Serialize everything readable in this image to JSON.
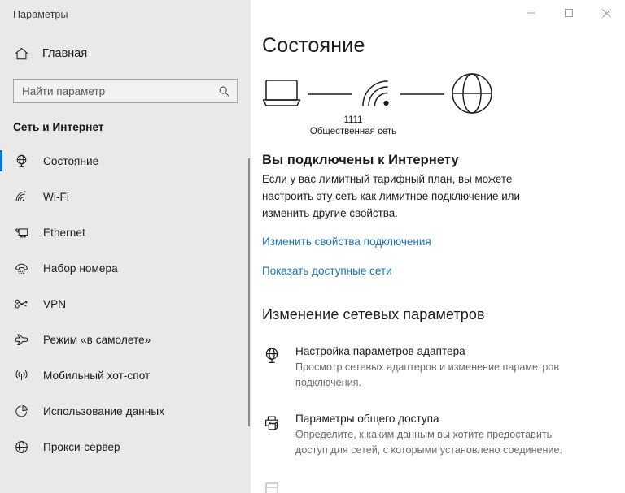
{
  "window": {
    "app_title": "Параметры",
    "controls": [
      {
        "name": "minimize",
        "label": "Свернуть"
      },
      {
        "name": "maximize",
        "label": "Развернуть"
      },
      {
        "name": "close",
        "label": "Закрыть"
      }
    ]
  },
  "sidebar": {
    "home_label": "Главная",
    "home_icon": "home-icon",
    "search": {
      "placeholder": "Найти параметр",
      "value": "",
      "icon": "search-icon"
    },
    "group_header": "Сеть и Интернет",
    "items": [
      {
        "label": "Состояние",
        "icon": "network-status-icon",
        "selected": true
      },
      {
        "label": "Wi-Fi",
        "icon": "wifi-icon",
        "selected": false
      },
      {
        "label": "Ethernet",
        "icon": "ethernet-icon",
        "selected": false
      },
      {
        "label": "Набор номера",
        "icon": "dialup-phone-icon",
        "selected": false
      },
      {
        "label": "VPN",
        "icon": "vpn-icon",
        "selected": false
      },
      {
        "label": "Режим «в самолете»",
        "icon": "airplane-icon",
        "selected": false
      },
      {
        "label": "Мобильный хот-спот",
        "icon": "hotspot-icon",
        "selected": false
      },
      {
        "label": "Использование данных",
        "icon": "data-usage-pie-icon",
        "selected": false
      },
      {
        "label": "Прокси-сервер",
        "icon": "proxy-globe-icon",
        "selected": false
      }
    ]
  },
  "main": {
    "page_title": "Состояние",
    "diagram": {
      "device_icon": "laptop-icon",
      "link_icon": "wifi-signal-icon",
      "internet_icon": "globe-icon",
      "ssid": "1111",
      "network_type": "Общественная сеть"
    },
    "status": {
      "heading": "Вы подключены к Интернету",
      "description": "Если у вас лимитный тарифный план, вы можете настроить эту сеть как лимитное подключение или изменить другие свойства."
    },
    "links": [
      {
        "label": "Изменить свойства подключения"
      },
      {
        "label": "Показать доступные сети"
      }
    ],
    "settings_section": {
      "heading": "Изменение сетевых параметров",
      "options": [
        {
          "icon": "adapter-globe-icon",
          "title": "Настройка параметров адаптера",
          "description": "Просмотр сетевых адаптеров и изменение параметров подключения."
        },
        {
          "icon": "sharing-printer-icon",
          "title": "Параметры общего доступа",
          "description": "Определите, к каким данным вы хотите предоставить доступ для сетей, с которыми установлено соединение."
        }
      ]
    }
  },
  "colors": {
    "accent": "#0078d7",
    "link": "#1a72b8",
    "sidebar_bg": "#e9e9e9",
    "main_bg": "#ffffff",
    "text": "#1b1b1b",
    "muted_text": "#6b6b6b"
  }
}
